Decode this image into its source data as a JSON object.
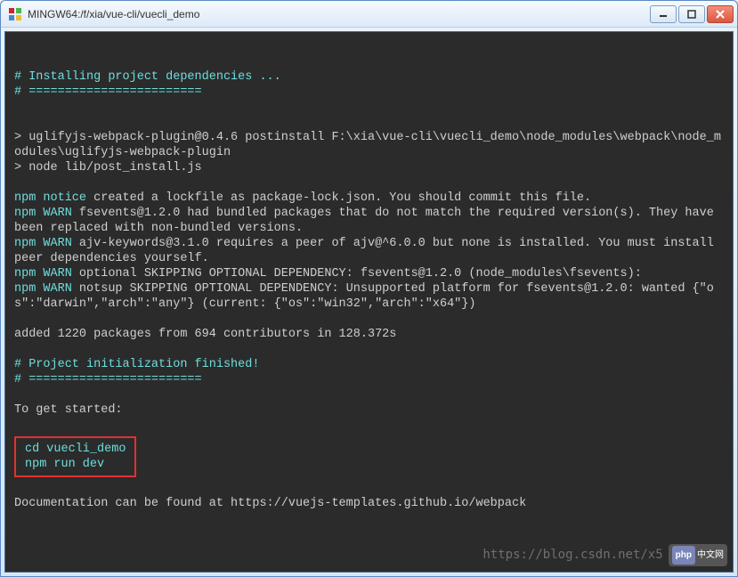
{
  "window": {
    "title": "MINGW64:/f/xia/vue-cli/vuecli_demo"
  },
  "terminal": {
    "l1": "# Installing project dependencies ...",
    "l2": "# ========================",
    "l3": "> uglifyjs-webpack-plugin@0.4.6 postinstall F:\\xia\\vue-cli\\vuecli_demo\\node_modules\\webpack\\node_modules\\uglifyjs-webpack-plugin",
    "l4": "> node lib/post_install.js",
    "l5": "npm notice",
    "l5b": " created a lockfile as package-lock.json. You should commit this file.",
    "l6": "npm WARN",
    "l6b": " fsevents@1.2.0 had bundled packages that do not match the required version(s). They have been replaced with non-bundled versions.",
    "l7": "npm WARN",
    "l7b": " ajv-keywords@3.1.0 requires a peer of ajv@^6.0.0 but none is installed. You must install peer dependencies yourself.",
    "l8": "npm WARN",
    "l8b": " optional SKIPPING OPTIONAL DEPENDENCY: fsevents@1.2.0 (node_modules\\fsevents):",
    "l9": "npm WARN",
    "l9b": " notsup SKIPPING OPTIONAL DEPENDENCY: Unsupported platform for fsevents@1.2.0: wanted {\"os\":\"darwin\",\"arch\":\"any\"} (current: {\"os\":\"win32\",\"arch\":\"x64\"})",
    "l10": "added 1220 packages from 694 contributors in 128.372s",
    "l11": "# Project initialization finished!",
    "l12": "# ========================",
    "l13": "To get started:",
    "box1": "cd vuecli_demo",
    "box2": "npm run dev",
    "l14": "Documentation can be found at https://vuejs-templates.github.io/webpack"
  },
  "watermark": {
    "url": "https://blog.csdn.net/x5",
    "badge_php": "php",
    "badge_cn": "中文网"
  }
}
